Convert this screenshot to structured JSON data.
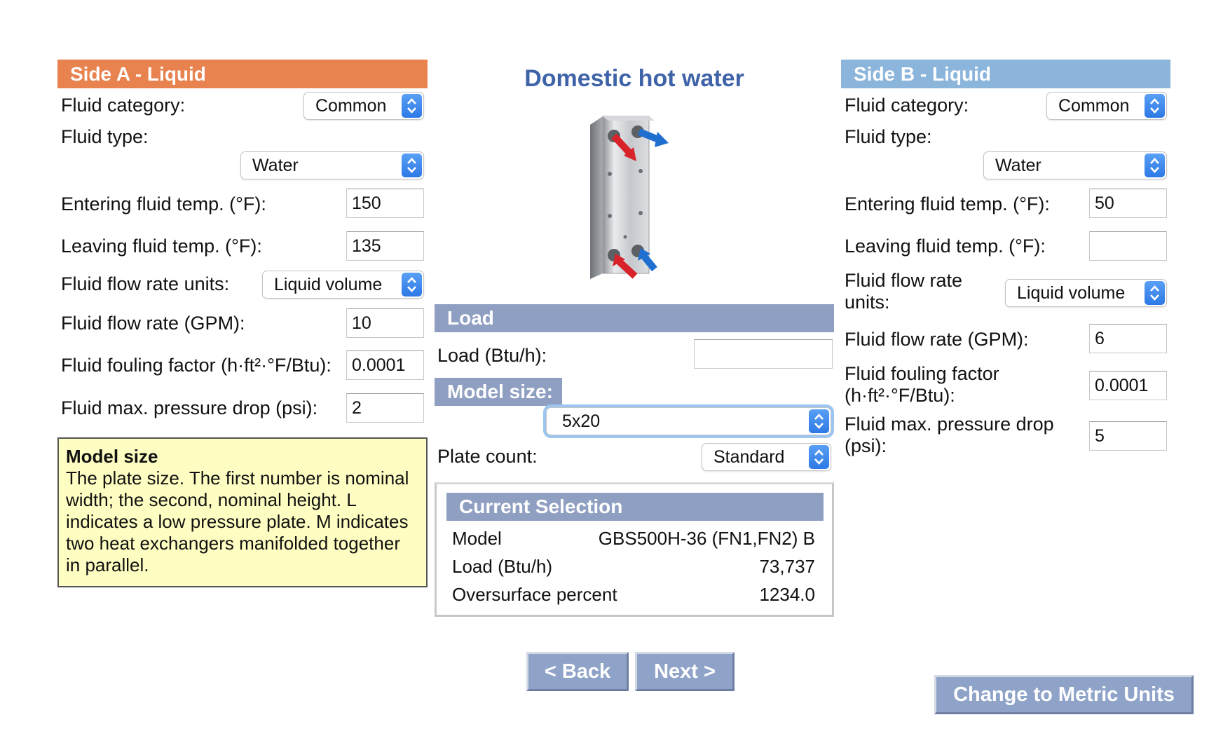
{
  "side_a": {
    "title": "Side A - Liquid",
    "fluid_category_label": "Fluid category:",
    "fluid_category_value": "Common",
    "fluid_type_label": "Fluid type:",
    "fluid_type_value": "Water",
    "entering_temp_label": "Entering fluid temp. (°F):",
    "entering_temp_value": "150",
    "leaving_temp_label": "Leaving fluid temp. (°F):",
    "leaving_temp_value": "135",
    "flow_units_label": "Fluid flow rate units:",
    "flow_units_value": "Liquid volume",
    "flow_rate_label": "Fluid flow rate (GPM):",
    "flow_rate_value": "10",
    "fouling_label": "Fluid fouling factor (h·ft²·°F/Btu):",
    "fouling_value": "0.0001",
    "pressure_drop_label": "Fluid max. pressure drop (psi):",
    "pressure_drop_value": "2"
  },
  "tooltip": {
    "title": "Model size",
    "body": "The plate size. The first number is nominal width; the second, nominal height. L indicates a low pressure plate. M indicates two heat exchangers manifolded together in parallel."
  },
  "center": {
    "title": "Domestic hot water",
    "load_header": "Load",
    "load_label": "Load (Btu/h):",
    "load_value": "",
    "model_size_header": "Model size:",
    "model_size_value": "5x20",
    "plate_count_label": "Plate count:",
    "plate_count_value": "Standard",
    "current_selection": {
      "title": "Current Selection",
      "rows": [
        {
          "label": "Model",
          "value": "GBS500H-36 (FN1,FN2) B"
        },
        {
          "label": "Load (Btu/h)",
          "value": "73,737"
        },
        {
          "label": "Oversurface percent",
          "value": "1234.0"
        }
      ]
    }
  },
  "side_b": {
    "title": "Side B - Liquid",
    "fluid_category_label": "Fluid category:",
    "fluid_category_value": "Common",
    "fluid_type_label": "Fluid type:",
    "fluid_type_value": "Water",
    "entering_temp_label": "Entering fluid temp. (°F):",
    "entering_temp_value": "50",
    "leaving_temp_label": "Leaving fluid temp. (°F):",
    "leaving_temp_value": "",
    "flow_units_label_line1": "Fluid flow rate",
    "flow_units_label_line2": "units:",
    "flow_units_value": "Liquid volume",
    "flow_rate_label": "Fluid flow rate (GPM):",
    "flow_rate_value": "6",
    "fouling_label_line1": "Fluid fouling factor",
    "fouling_label_line2": "(h·ft²·°F/Btu):",
    "fouling_value": "0.0001",
    "pressure_drop_label_line1": "Fluid max. pressure drop",
    "pressure_drop_label_line2": "(psi):",
    "pressure_drop_value": "5"
  },
  "nav": {
    "back_label": "< Back",
    "next_label": "Next >",
    "metric_label": "Change to Metric Units"
  },
  "icons": {
    "select_arrow": "updown-chevron-icon",
    "product_image": "plate-heat-exchanger-icon",
    "hot_arrow_color": "#d9232a",
    "cold_arrow_color": "#1f6fd1"
  },
  "colors": {
    "side_a_header": "#e8824e",
    "side_b_header": "#8cb5dc",
    "section_header": "#8f9fc2",
    "title_blue": "#3f63a8",
    "tooltip_bg": "#fefec2"
  }
}
